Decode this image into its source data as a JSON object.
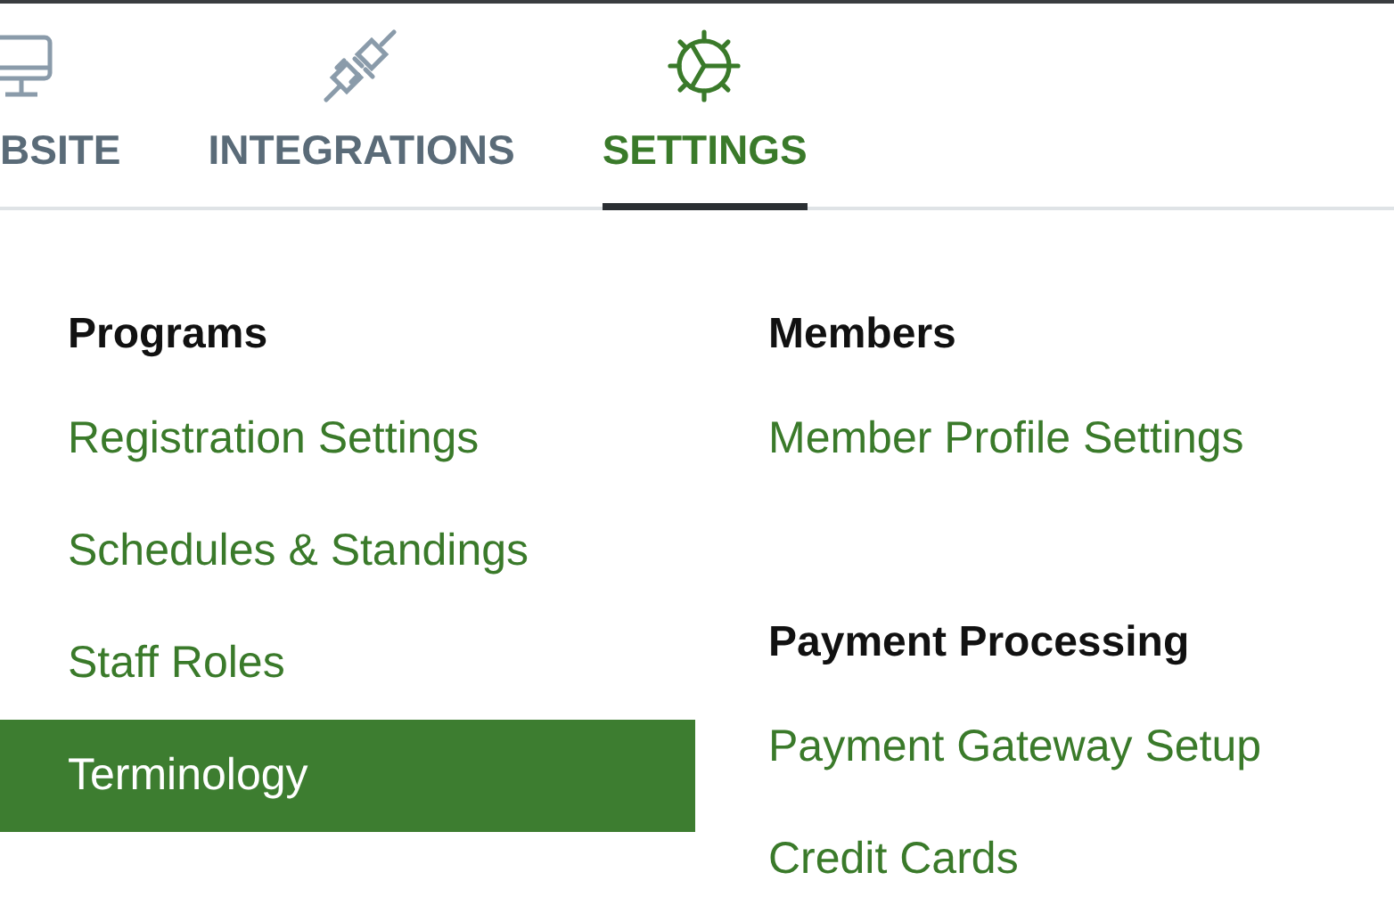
{
  "tabs": [
    {
      "label": "BSITE",
      "kind": "monitor",
      "selected": false
    },
    {
      "label": "INTEGRATIONS",
      "kind": "plug",
      "selected": false
    },
    {
      "label": "SETTINGS",
      "kind": "gear",
      "selected": true
    }
  ],
  "menu": {
    "columns": [
      {
        "groups": [
          {
            "title": "Programs",
            "items": [
              {
                "label": "Registration Settings",
                "selected": false
              },
              {
                "label": "Schedules & Standings",
                "selected": false
              },
              {
                "label": "Staff Roles",
                "selected": false
              },
              {
                "label": "Terminology",
                "selected": true
              }
            ]
          }
        ]
      },
      {
        "groups": [
          {
            "title": "Members",
            "items": [
              {
                "label": "Member Profile Settings",
                "selected": false
              }
            ]
          },
          {
            "title": "Payment Processing",
            "items": [
              {
                "label": "Payment Gateway Setup",
                "selected": false
              },
              {
                "label": "Credit Cards",
                "selected": false
              }
            ]
          }
        ]
      }
    ]
  }
}
